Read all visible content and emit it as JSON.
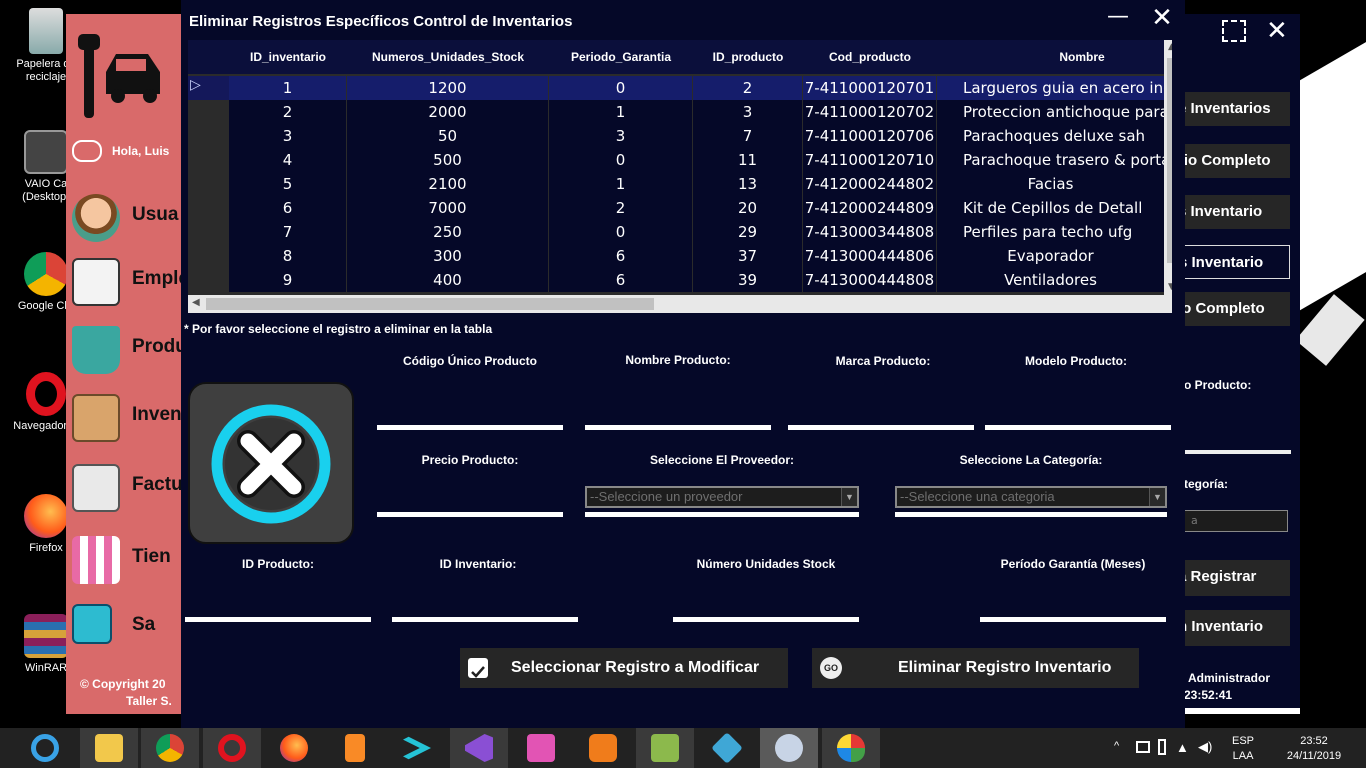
{
  "desktop": {
    "icons": [
      {
        "label": "Papelera de reciclaje"
      },
      {
        "label": "VAIO Ca (Desktop)"
      },
      {
        "label": "Google Chr"
      },
      {
        "label": "Navegador O"
      },
      {
        "label": "Firefox"
      },
      {
        "label": "WinRAR"
      }
    ]
  },
  "bg_app": {
    "greeting": "Hola, Luis",
    "menu": [
      "Usua",
      "Emple",
      "Produ",
      "Inven",
      "Factu",
      "Tien",
      "Sa"
    ],
    "copyright_line1": "© Copyright 20",
    "copyright_line2": "Taller S.",
    "right_buttons": [
      "e Inventarios",
      "rio Completo",
      "s Inventario",
      "s Inventario",
      "io Completo",
      "a Registrar",
      "n Inventario"
    ],
    "right_label1": "o Producto:",
    "right_label2": "tegoría:",
    "right_combo": "a",
    "right_user": "Administrador",
    "right_time": "23:52:41"
  },
  "dialog": {
    "title": "Eliminar Registros Específicos Control de Inventarios",
    "minimize": "—",
    "close": "✕",
    "table": {
      "columns": [
        "ID_inventario",
        "Numeros_Unidades_Stock",
        "Periodo_Garantia",
        "ID_producto",
        "Cod_producto",
        "Nombre"
      ],
      "rows": [
        [
          "1",
          "1200",
          "0",
          "2",
          "7-411000120701",
          "Largueros guia en acero inox"
        ],
        [
          "2",
          "2000",
          "1",
          "3",
          "7-411000120702",
          "Proteccion antichoque para conduct"
        ],
        [
          "3",
          "50",
          "3",
          "7",
          "7-411000120706",
          "Parachoques deluxe sah"
        ],
        [
          "4",
          "500",
          "0",
          "11",
          "7-411000120710",
          "Parachoque trasero & porta"
        ],
        [
          "5",
          "2100",
          "1",
          "13",
          "7-412000244802",
          "Facias"
        ],
        [
          "6",
          "7000",
          "2",
          "20",
          "7-412000244809",
          "Kit de Cepillos de Detall"
        ],
        [
          "7",
          "250",
          "0",
          "29",
          "7-413000344808",
          "Perfiles para techo ufg"
        ],
        [
          "8",
          "300",
          "6",
          "37",
          "7-413000444806",
          "Evaporador"
        ],
        [
          "9",
          "400",
          "6",
          "39",
          "7-413000444808",
          "Ventiladores"
        ]
      ],
      "selected_row": 0
    },
    "note": "* Por favor seleccione el registro a eliminar en la tabla",
    "fields": {
      "codigo": "Código Único Producto",
      "nombre": "Nombre Producto:",
      "marca": "Marca Producto:",
      "modelo": "Modelo Producto:",
      "precio": "Precio Producto:",
      "proveedor": "Seleccione El Proveedor:",
      "categoria": "Seleccione La Categoría:",
      "id_producto": "ID Producto:",
      "id_inventario": "ID Inventario:",
      "unidades": "Número Unidades Stock",
      "garantia": "Período Garantía (Meses)"
    },
    "combos": {
      "proveedor_placeholder": "--Seleccione un proveedor",
      "categoria_placeholder": "--Seleccione una categoria"
    },
    "buttons": {
      "select": "Seleccionar Registro a Modificar",
      "delete": "Eliminar Registro Inventario",
      "go_badge": "GO"
    }
  },
  "taskbar": {
    "apps": [
      "internet-explorer",
      "file-explorer",
      "chrome",
      "opera",
      "firefox",
      "sublime-text",
      "vscode",
      "visual-studio",
      "winamp",
      "xampp",
      "tools",
      "box-app",
      "sql-tool",
      "paint"
    ],
    "lang1": "ESP",
    "lang2": "LAA",
    "time": "23:52",
    "date": "24/11/2019"
  },
  "colors": {
    "dialog_bg": "#050828",
    "sidebar": "#d96a6a",
    "selected_row": "#151d6b",
    "button": "#262626",
    "delete_ring": "#19d0ee"
  }
}
